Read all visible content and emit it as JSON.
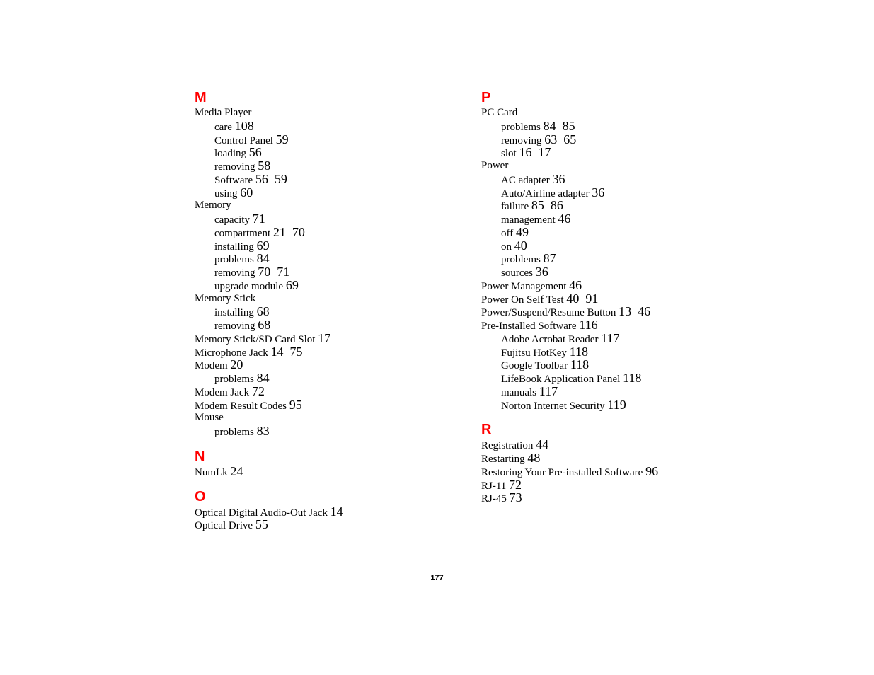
{
  "page_number": "177",
  "colors": {
    "section_letter": "#ff0000",
    "text": "#000000"
  },
  "left_column": [
    {
      "letter": "M",
      "entries": [
        {
          "text": "Media Player",
          "pages": "",
          "sub": false
        },
        {
          "text": "care",
          "pages": "108",
          "sub": true
        },
        {
          "text": "Control Panel",
          "pages": "59",
          "sub": true
        },
        {
          "text": "loading",
          "pages": "56",
          "sub": true
        },
        {
          "text": "removing",
          "pages": "58",
          "sub": true
        },
        {
          "text": "Software",
          "pages": "56  59",
          "sub": true
        },
        {
          "text": "using",
          "pages": "60",
          "sub": true
        },
        {
          "text": "Memory",
          "pages": "",
          "sub": false
        },
        {
          "text": "capacity",
          "pages": "71",
          "sub": true
        },
        {
          "text": "compartment",
          "pages": "21  70",
          "sub": true
        },
        {
          "text": "installing",
          "pages": "69",
          "sub": true
        },
        {
          "text": "problems",
          "pages": "84",
          "sub": true
        },
        {
          "text": "removing",
          "pages": "70  71",
          "sub": true
        },
        {
          "text": "upgrade module",
          "pages": "69",
          "sub": true
        },
        {
          "text": "Memory Stick",
          "pages": "",
          "sub": false
        },
        {
          "text": "installing",
          "pages": "68",
          "sub": true
        },
        {
          "text": "removing",
          "pages": "68",
          "sub": true
        },
        {
          "text": "Memory Stick/SD Card Slot",
          "pages": "17",
          "sub": false
        },
        {
          "text": "Microphone Jack",
          "pages": "14  75",
          "sub": false
        },
        {
          "text": "Modem",
          "pages": "20",
          "sub": false
        },
        {
          "text": "problems",
          "pages": "84",
          "sub": true
        },
        {
          "text": "Modem Jack",
          "pages": "72",
          "sub": false
        },
        {
          "text": "Modem Result Codes",
          "pages": "95",
          "sub": false
        },
        {
          "text": "Mouse",
          "pages": "",
          "sub": false
        },
        {
          "text": "problems",
          "pages": "83",
          "sub": true
        }
      ]
    },
    {
      "letter": "N",
      "entries": [
        {
          "text": "NumLk",
          "pages": "24",
          "sub": false
        }
      ]
    },
    {
      "letter": "O",
      "entries": [
        {
          "text": "Optical Digital Audio-Out Jack",
          "pages": "14",
          "sub": false
        },
        {
          "text": "Optical Drive",
          "pages": "55",
          "sub": false
        }
      ]
    }
  ],
  "right_column": [
    {
      "letter": "P",
      "entries": [
        {
          "text": "PC Card",
          "pages": "",
          "sub": false
        },
        {
          "text": "problems",
          "pages": "84  85",
          "sub": true
        },
        {
          "text": "removing",
          "pages": "63  65",
          "sub": true
        },
        {
          "text": "slot",
          "pages": "16  17",
          "sub": true
        },
        {
          "text": "Power",
          "pages": "",
          "sub": false
        },
        {
          "text": "AC adapter",
          "pages": "36",
          "sub": true
        },
        {
          "text": "Auto/Airline adapter",
          "pages": "36",
          "sub": true
        },
        {
          "text": "failure",
          "pages": "85  86",
          "sub": true
        },
        {
          "text": "management",
          "pages": "46",
          "sub": true
        },
        {
          "text": "off",
          "pages": "49",
          "sub": true
        },
        {
          "text": "on",
          "pages": "40",
          "sub": true
        },
        {
          "text": "problems",
          "pages": "87",
          "sub": true
        },
        {
          "text": "sources",
          "pages": "36",
          "sub": true
        },
        {
          "text": "Power Management",
          "pages": "46",
          "sub": false
        },
        {
          "text": "Power On Self Test",
          "pages": "40  91",
          "sub": false
        },
        {
          "text": "Power/Suspend/Resume Button",
          "pages": "13  46",
          "sub": false
        },
        {
          "text": "Pre-Installed Software",
          "pages": "116",
          "sub": false
        },
        {
          "text": "Adobe Acrobat Reader",
          "pages": "117",
          "sub": true
        },
        {
          "text": "Fujitsu HotKey",
          "pages": "118",
          "sub": true
        },
        {
          "text": "Google Toolbar",
          "pages": "118",
          "sub": true
        },
        {
          "text": "LifeBook Application Panel",
          "pages": "118",
          "sub": true
        },
        {
          "text": "manuals",
          "pages": "117",
          "sub": true
        },
        {
          "text": "Norton Internet Security",
          "pages": "119",
          "sub": true
        }
      ]
    },
    {
      "letter": "R",
      "entries": [
        {
          "text": "Registration",
          "pages": "44",
          "sub": false
        },
        {
          "text": "Restarting",
          "pages": "48",
          "sub": false
        },
        {
          "text": "Restoring Your Pre-installed Software",
          "pages": "96",
          "sub": false
        },
        {
          "text": "RJ-11",
          "pages": "72",
          "sub": false
        },
        {
          "text": "RJ-45",
          "pages": "73",
          "sub": false
        }
      ]
    }
  ]
}
